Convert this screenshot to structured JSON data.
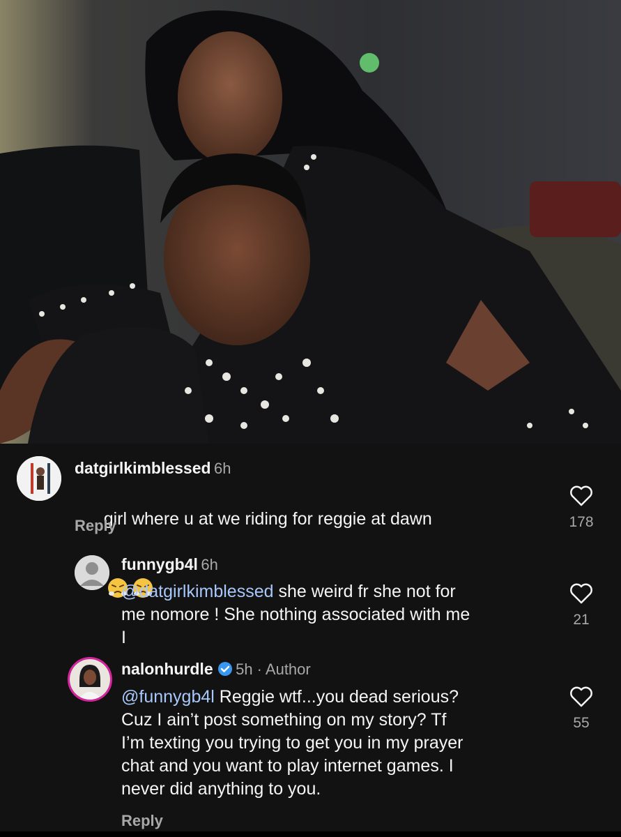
{
  "post": {
    "image_description_icon": "photo-of-two-people"
  },
  "comments": [
    {
      "username": "datgirlkimblessed",
      "time": "6h",
      "text": "girl where u at we riding for reggie at dawn",
      "emojis": [
        "face-with-steam-icon",
        "face-with-steam-icon"
      ],
      "reply_label": "Reply",
      "likes": "178"
    },
    {
      "username": "funnygb4l",
      "time": "6h",
      "mention": "@datgirlkimblessed",
      "text": " she weird fr she not for\nme nomore ! She nothing associated with me\nI",
      "likes": "21"
    },
    {
      "username": "nalonhurdle",
      "time": "5h",
      "author_tag": "Author",
      "mention": "@funnygb4l",
      "text": " Reggie wtf...you dead serious?\nCuz I ain’t post something on my story? Tf\nI’m texting you trying to get you in my prayer\nchat and you want to play internet games. I\nnever did anything to you.",
      "reply_label": "Reply",
      "likes": "55"
    }
  ],
  "separators": {
    "dot": " · "
  }
}
